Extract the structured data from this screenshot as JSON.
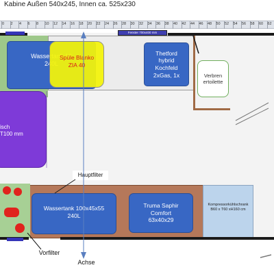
{
  "title": "Kabine Außen 540x245, Innen ca. 525x230",
  "ruler": {
    "ticks": [
      "0",
      "2",
      "4",
      "6",
      "8",
      "10",
      "12",
      "14",
      "16",
      "18",
      "20",
      "22",
      "24",
      "26",
      "28",
      "30",
      "32",
      "34",
      "36",
      "38",
      "40",
      "42",
      "44",
      "46",
      "48",
      "50",
      "52",
      "54",
      "56",
      "58",
      "60",
      "62"
    ]
  },
  "fenster_top": "Fenster 700x400 mm",
  "wassertank_top": {
    "line1": "Wassertank 10",
    "line2": "240L"
  },
  "spuele": {
    "line1": "Spüle Blanko",
    "line2": "ZIA 40"
  },
  "thetford": {
    "line1": "Thetford",
    "line2": "hybrid",
    "line3": "Kochfeld",
    "line4": "2xGas, 1x"
  },
  "toilette": {
    "line1": "Verbren",
    "line2": "ertoilette"
  },
  "bed": {
    "line1": "isch",
    "line2": "T100 mm"
  },
  "hauptfilter": "Hauptfilter",
  "wassertank_bottom": {
    "line1": "Wassertank 100x45x55",
    "line2": "240L"
  },
  "truma": {
    "line1": "Truma Saphir",
    "line2": "Comfort",
    "line3": "63x40x29"
  },
  "kompressor": {
    "line1": "Kompressorkühlschrank",
    "line2": "B60 x T60 xH160 cm"
  },
  "vorfilter": "Vorfilter",
  "achse": "Achse",
  "colors": {
    "blue_box": "#3867c4",
    "yellow": "#f4f40a",
    "purple": "#7e3ad8",
    "green_panel": "#9ec88a",
    "brown_cabinet": "#b5785a",
    "light_blue": "#bcd4ec",
    "red": "#e0231d",
    "wall_black": "#1a1a1a"
  }
}
